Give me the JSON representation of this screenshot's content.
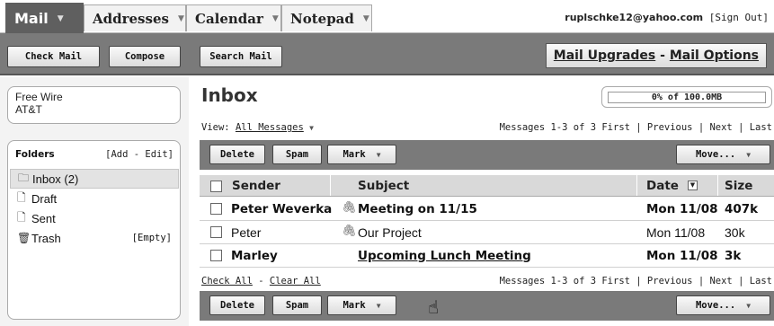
{
  "tabs": [
    {
      "label": "Mail",
      "active": true
    },
    {
      "label": "Addresses"
    },
    {
      "label": "Calendar"
    },
    {
      "label": "Notepad"
    }
  ],
  "account": {
    "email": "ruplschke12@yahoo.com",
    "signout": "[Sign Out]"
  },
  "toolbar": {
    "check_mail": "Check Mail",
    "compose": "Compose",
    "search_mail": "Search Mail",
    "upgrades": "Mail Upgrades",
    "separator": " - ",
    "options": "Mail Options"
  },
  "sidebar": {
    "ad_line1": "Free Wire",
    "ad_line2": "AT&T",
    "folders_label": "Folders",
    "add_edit": "[Add - Edit]",
    "folders": [
      {
        "label": "Inbox (2)",
        "icon": "inbox-icon"
      },
      {
        "label": "Draft",
        "icon": "draft-icon"
      },
      {
        "label": "Sent",
        "icon": "sent-icon"
      },
      {
        "label": "Trash",
        "icon": "trash-icon"
      }
    ],
    "empty": "[Empty]"
  },
  "main": {
    "title": "Inbox",
    "quota": {
      "text": "0% of 100.0MB",
      "fraction": 0.0
    },
    "view_label": "View:",
    "view_value": "All Messages",
    "pager": "Messages 1-3 of 3  First | Previous | Next | Last",
    "actions": {
      "delete": "Delete",
      "spam": "Spam",
      "mark": "Mark",
      "move": "Move..."
    },
    "columns": {
      "sender": "Sender",
      "subject": "Subject",
      "date": "Date",
      "size": "Size"
    },
    "messages": [
      {
        "sender": "Peter Weverka",
        "subject": "Meeting on 11/15",
        "date": "Mon 11/08",
        "size": "407k",
        "unread": true,
        "attachment": true
      },
      {
        "sender": "Peter",
        "subject": "Our Project",
        "date": "Mon 11/08",
        "size": "30k",
        "unread": false,
        "attachment": true
      },
      {
        "sender": "Marley",
        "subject": "Upcoming Lunch Meeting",
        "date": "Mon 11/08",
        "size": "3k",
        "unread": true,
        "attachment": false
      }
    ],
    "check_all": "Check All",
    "clear_all": "Clear All",
    "footer_sep": " - "
  }
}
